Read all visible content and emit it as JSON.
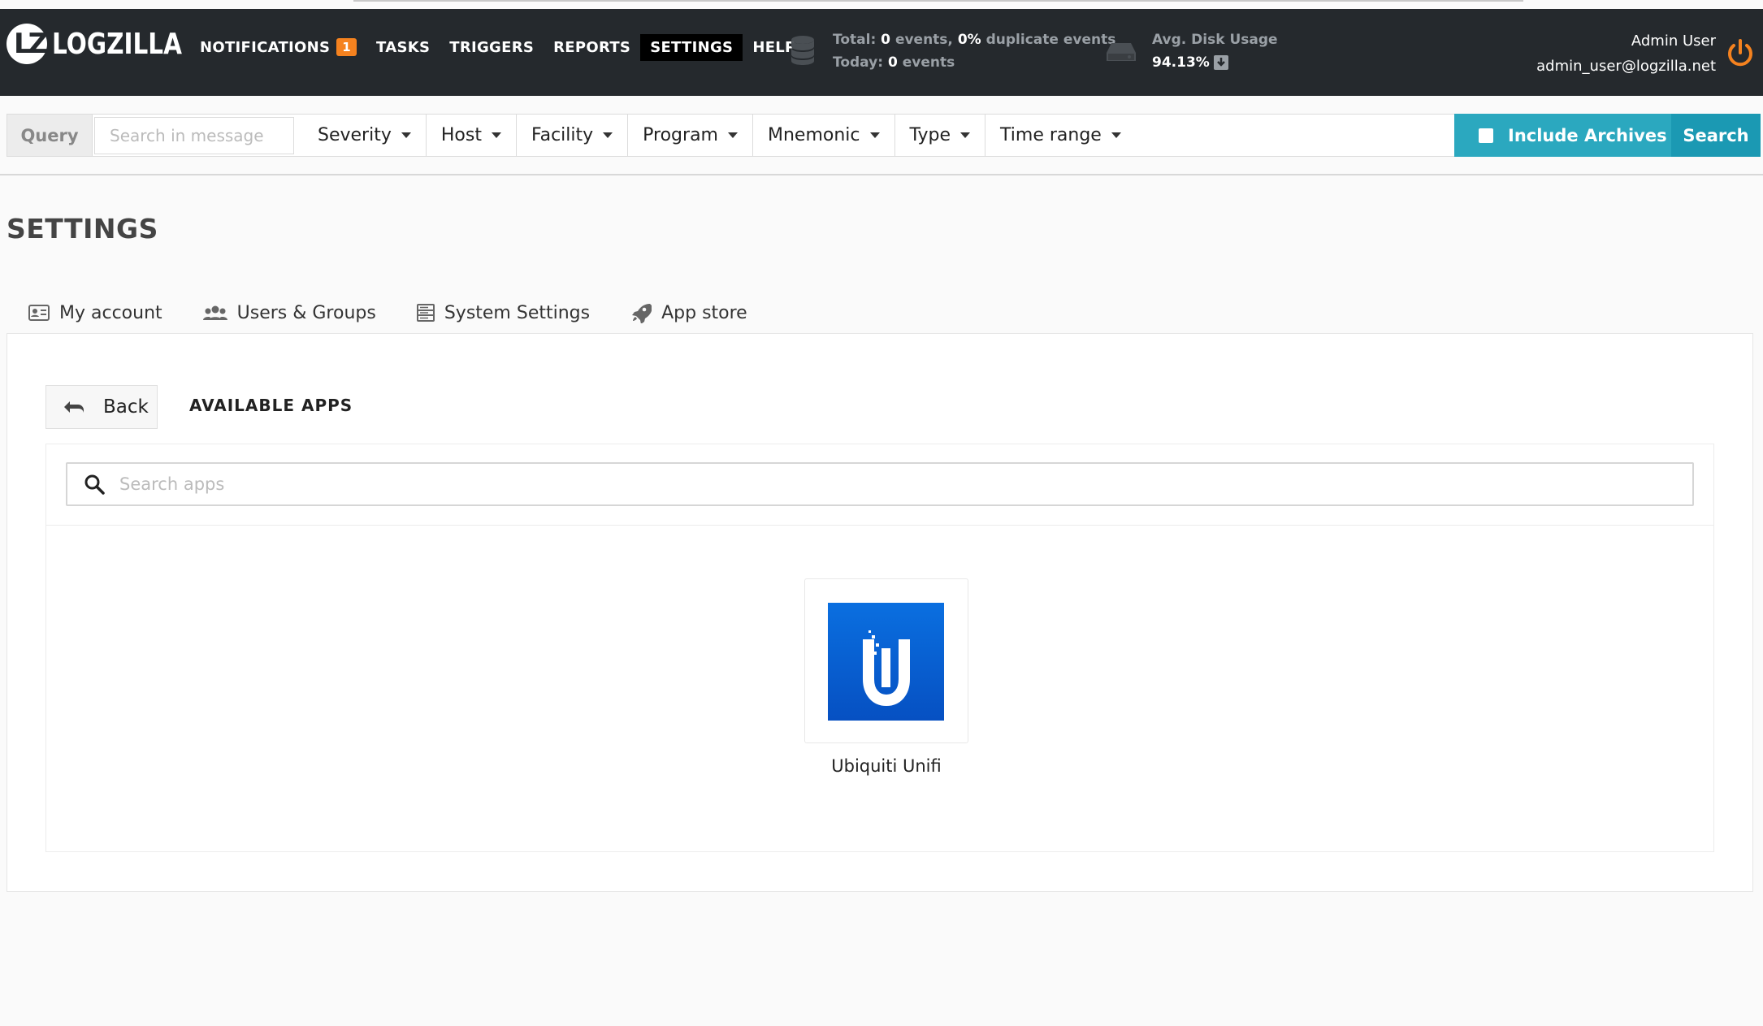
{
  "brand": {
    "name": "LOGZILLA",
    "mark": "LZ"
  },
  "nav": {
    "items": [
      {
        "label": "NOTIFICATIONS",
        "badge": "1"
      },
      {
        "label": "TASKS"
      },
      {
        "label": "TRIGGERS"
      },
      {
        "label": "REPORTS"
      },
      {
        "label": "SETTINGS",
        "active": true
      },
      {
        "label": "HELP"
      }
    ]
  },
  "stats": {
    "total_label": "Total:",
    "total_value": "0",
    "events_word": "events,",
    "dup_value": "0%",
    "dup_label": "duplicate events",
    "today_label": "Today:",
    "today_value": "0",
    "today_events_word": "events",
    "disk_label": "Avg. Disk Usage",
    "disk_value": "94.13%"
  },
  "user": {
    "name": "Admin User",
    "email": "admin_user@logzilla.net"
  },
  "query": {
    "label": "Query",
    "placeholder": "Search in message",
    "filters": [
      "Severity",
      "Host",
      "Facility",
      "Program",
      "Mnemonic",
      "Type",
      "Time range"
    ],
    "include_archives": "Include Archives",
    "search": "Search"
  },
  "page": {
    "title": "SETTINGS"
  },
  "tabs": [
    {
      "label": "My account",
      "icon": "id-card-icon"
    },
    {
      "label": "Users & Groups",
      "icon": "users-icon"
    },
    {
      "label": "System Settings",
      "icon": "server-icon"
    },
    {
      "label": "App store",
      "icon": "rocket-icon"
    }
  ],
  "appstore": {
    "back": "Back",
    "title": "AVAILABLE APPS",
    "search_placeholder": "Search apps",
    "apps": [
      {
        "name": "Ubiquiti Unifi",
        "logo": "ubiquiti-logo"
      }
    ]
  },
  "colors": {
    "navbar": "#25292d",
    "accent": "#2ba8bf",
    "search": "#1b99b3",
    "badge": "#f5821f",
    "power": "#f5821f"
  }
}
